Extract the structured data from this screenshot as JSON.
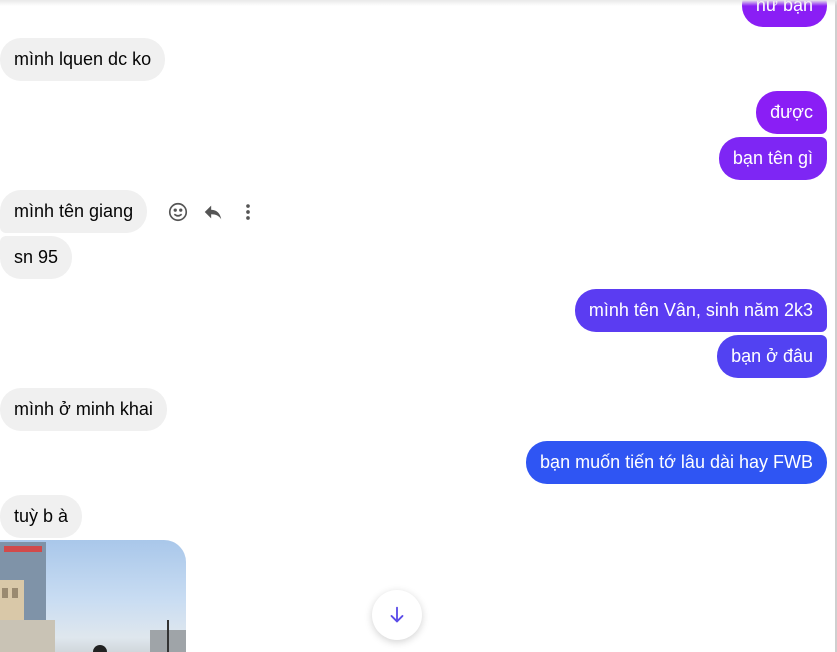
{
  "messages": {
    "out_0": "nữ bạn",
    "in_1": "mình lquen dc ko",
    "out_2": "được",
    "out_3": "bạn tên gì",
    "in_4": "mình tên giang",
    "in_5": "sn 95",
    "out_6": "mình tên Vân, sinh năm 2k3",
    "out_7": "bạn ở đâu",
    "in_8": "mình ở minh khai",
    "out_9": "bạn muốn tiến tớ lâu dài hay FWB",
    "in_10": "tuỳ b à"
  },
  "hover_actions": [
    "smiley-icon",
    "reply-icon",
    "more-vertical-icon"
  ],
  "scroll_button": "arrow-down-icon",
  "colors": {
    "incoming_bg": "#f0f0f0",
    "outgoing_gradient": [
      "#8a1ef5",
      "#7a2cf3",
      "#5a3df2",
      "#2f55f3"
    ],
    "scroll_arrow": "#5b4ce8"
  }
}
